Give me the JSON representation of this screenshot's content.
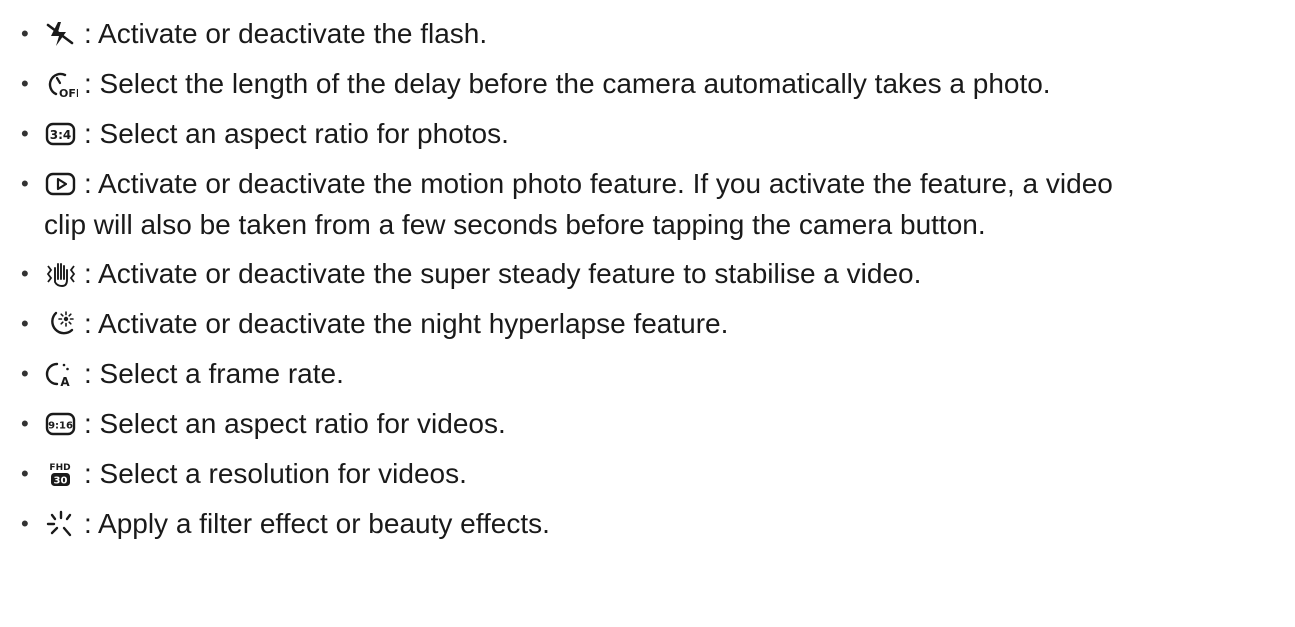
{
  "items": [
    {
      "icon": "flash-off-icon",
      "text": ": Activate or deactivate the flash."
    },
    {
      "icon": "timer-off-icon",
      "text": ": Select the length of the delay before the camera automatically takes a photo."
    },
    {
      "icon": "aspect-ratio-3-4-icon",
      "icon_text": "3:4",
      "text": ": Select an aspect ratio for photos."
    },
    {
      "icon": "motion-photo-icon",
      "text": ": Activate or deactivate the motion photo feature. If you activate the feature, a video",
      "text2": "clip will also be taken from a few seconds before tapping the camera button."
    },
    {
      "icon": "super-steady-icon",
      "text": ": Activate or deactivate the super steady feature to stabilise a video."
    },
    {
      "icon": "night-hyperlapse-icon",
      "text": ": Activate or deactivate the night hyperlapse feature."
    },
    {
      "icon": "frame-rate-icon",
      "icon_text": "A",
      "text": ": Select a frame rate."
    },
    {
      "icon": "aspect-ratio-9-16-icon",
      "icon_text": "9:16",
      "text": ": Select an aspect ratio for videos."
    },
    {
      "icon": "resolution-fhd-30-icon",
      "icon_text": "FHD",
      "icon_text2": "30",
      "text": ": Select a resolution for videos."
    },
    {
      "icon": "filter-effects-icon",
      "text": ": Apply a filter effect or beauty effects."
    }
  ]
}
